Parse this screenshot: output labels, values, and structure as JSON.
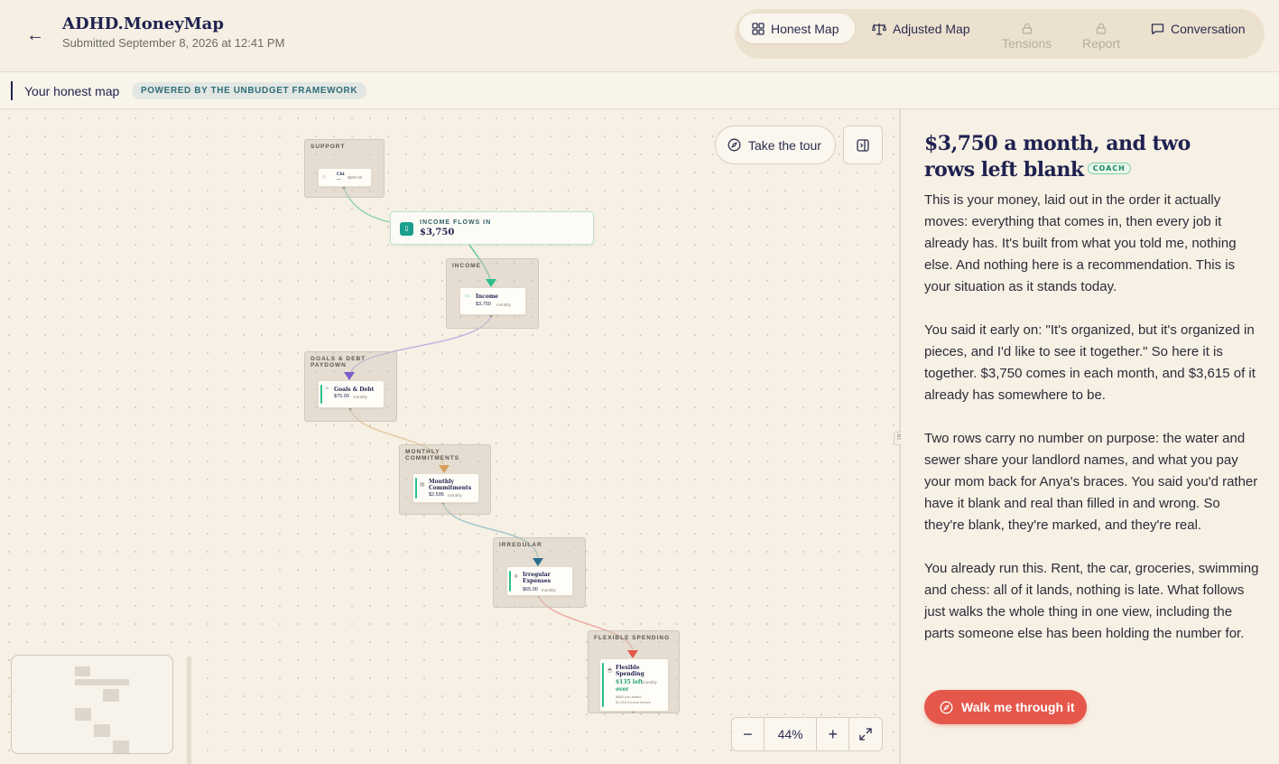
{
  "header": {
    "title": "ADHD.MoneyMap",
    "subtitle": "Submitted September 8, 2026 at 12:41 PM",
    "tabs": [
      {
        "label": "Honest Map",
        "icon": "grid-icon",
        "state": "active"
      },
      {
        "label": "Adjusted Map",
        "icon": "scale-icon",
        "state": "normal"
      },
      {
        "label": "Tensions",
        "icon": "lock-icon",
        "state": "locked"
      },
      {
        "label": "Report",
        "icon": "lock-icon",
        "state": "locked"
      },
      {
        "label": "Conversation",
        "icon": "chat-icon",
        "state": "normal"
      }
    ]
  },
  "subheader": {
    "label": "Your honest map",
    "badge": "POWERED BY THE UNBUDGET FRAMEWORK"
  },
  "map": {
    "income_banner": {
      "label": "INCOME FLOWS IN",
      "value": "$3,750"
    },
    "groups": {
      "support": {
        "label": "SUPPORT",
        "card_title": "Chi ...",
        "card_amount": "$600.00"
      },
      "income": {
        "label": "INCOME",
        "card_title": "Income",
        "card_amount": "$3,750",
        "card_unit": "monthly"
      },
      "goals": {
        "label": "GOALS & DEBT PAYDOWN",
        "card_title": "Goals & Debt",
        "card_amount": "$75.00",
        "card_unit": "monthly"
      },
      "monthly": {
        "label": "MONTHLY COMMITMENTS",
        "card_title": "Monthly Commitments",
        "card_amount": "$2,595",
        "card_unit": "monthly"
      },
      "irregular": {
        "label": "IRREGULAR",
        "card_title": "Irregular Expenses",
        "card_amount": "$65.00",
        "card_unit": "monthly"
      },
      "flexible": {
        "label": "FLEXIBLE SPENDING",
        "card_title": "Flexible Spending",
        "card_amount": "$135 left",
        "card_unit": "monthly",
        "card_status": "over",
        "card_note": "$880 you stated",
        "card_note2": "$1,015 income leaves"
      }
    },
    "tour_label": "Take the tour",
    "zoom_level": "44%",
    "colors": {
      "income": "#2bbf8d",
      "goals": "#7b5cc9",
      "monthly": "#d7a05a",
      "irregular": "#2a6e8f",
      "flexible": "#e5574b"
    }
  },
  "panel": {
    "title": "$3,750 a month, and two rows left blank",
    "badge": "COACH",
    "paragraphs": [
      "This is your money, laid out in the order it actually moves: everything that comes in, then every job it already has. It's built from what you told me, nothing else. And nothing here is a recommendation. This is your situation as it stands today.",
      "You said it early on: \"It's organized, but it's organized in pieces, and I'd like to see it together.\" So here it is together. $3,750 comes in each month, and $3,615 of it already has somewhere to be.",
      "Two rows carry no number on purpose: the water and sewer share your landlord names, and what you pay your mom back for Anya's braces. You said you'd rather have it blank and real than filled in and wrong. So they're blank, they're marked, and they're real.",
      "You already run this. Rent, the car, groceries, swimming and chess: all of it lands, nothing is late. What follows just walks the whole thing in one view, including the parts someone else has been holding the number for."
    ],
    "cta": "Walk me through it"
  }
}
